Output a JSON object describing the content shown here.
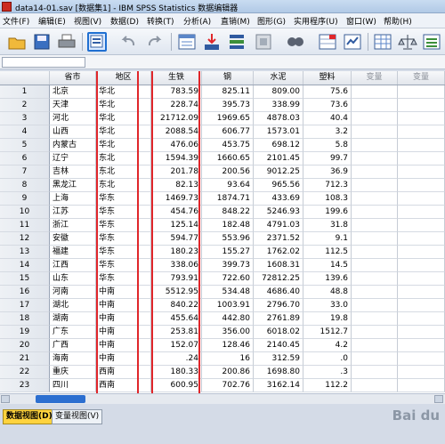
{
  "window": {
    "title": "data14-01.sav [数据集1] - IBM SPSS Statistics 数据编辑器"
  },
  "menu": [
    "文件(F)",
    "编辑(E)",
    "视图(V)",
    "数据(D)",
    "转换(T)",
    "分析(A)",
    "直销(M)",
    "图形(G)",
    "实用程序(U)",
    "窗口(W)",
    "帮助(H)"
  ],
  "toolbar": {
    "icons": [
      "open-folder",
      "save",
      "print",
      "dialog-recall",
      "undo",
      "redo",
      "go-to-case",
      "go-to-variable",
      "variables",
      "weight-cases",
      "find",
      "insert-cases",
      "insert-variable",
      "split-file",
      "select-cases",
      "value-labels",
      "use-variable-sets",
      "spelling"
    ]
  },
  "grid": {
    "headers": [
      "省市",
      "地区",
      "生铁",
      "钢",
      "水泥",
      "塑料",
      "变量",
      "变量"
    ],
    "rows": [
      {
        "n": "1",
        "c": [
          "北京",
          "华北",
          "783.59",
          "825.11",
          "809.00",
          "75.6"
        ]
      },
      {
        "n": "2",
        "c": [
          "天津",
          "华北",
          "228.74",
          "395.73",
          "338.99",
          "73.6"
        ]
      },
      {
        "n": "3",
        "c": [
          "河北",
          "华北",
          "21712.09",
          "1969.65",
          "4878.03",
          "40.4"
        ]
      },
      {
        "n": "4",
        "c": [
          "山西",
          "华北",
          "2088.54",
          "606.77",
          "1573.01",
          "3.2"
        ]
      },
      {
        "n": "5",
        "c": [
          "内蒙古",
          "华北",
          "476.06",
          "453.75",
          "698.12",
          "5.8"
        ]
      },
      {
        "n": "6",
        "c": [
          "辽宁",
          "东北",
          "1594.39",
          "1660.65",
          "2101.45",
          "99.7"
        ]
      },
      {
        "n": "7",
        "c": [
          "吉林",
          "东北",
          "201.78",
          "200.56",
          "9012.25",
          "36.9"
        ]
      },
      {
        "n": "8",
        "c": [
          "黑龙江",
          "东北",
          "82.13",
          "93.64",
          "965.56",
          "712.3"
        ]
      },
      {
        "n": "9",
        "c": [
          "上海",
          "华东",
          "1469.73",
          "1874.71",
          "433.69",
          "108.3"
        ]
      },
      {
        "n": "10",
        "c": [
          "江苏",
          "华东",
          "454.76",
          "848.22",
          "5246.93",
          "199.6"
        ]
      },
      {
        "n": "11",
        "c": [
          "浙江",
          "华东",
          "125.14",
          "182.48",
          "4791.03",
          "31.8"
        ]
      },
      {
        "n": "12",
        "c": [
          "安徽",
          "华东",
          "594.77",
          "553.96",
          "2371.52",
          "9.1"
        ]
      },
      {
        "n": "13",
        "c": [
          "福建",
          "华东",
          "180.23",
          "155.27",
          "1762.02",
          "112.5"
        ]
      },
      {
        "n": "14",
        "c": [
          "江西",
          "华东",
          "338.06",
          "399.73",
          "1608.31",
          "14.5"
        ]
      },
      {
        "n": "15",
        "c": [
          "山东",
          "华东",
          "793.91",
          "722.60",
          "72812.25",
          "139.6"
        ]
      },
      {
        "n": "16",
        "c": [
          "河南",
          "中南",
          "5512.95",
          "534.48",
          "4686.40",
          "48.8"
        ]
      },
      {
        "n": "17",
        "c": [
          "湖北",
          "中南",
          "840.22",
          "1003.91",
          "2796.70",
          "33.0"
        ]
      },
      {
        "n": "18",
        "c": [
          "湖南",
          "中南",
          "455.64",
          "442.80",
          "2761.89",
          "19.8"
        ]
      },
      {
        "n": "19",
        "c": [
          "广东",
          "中南",
          "253.81",
          "356.00",
          "6018.02",
          "1512.7"
        ]
      },
      {
        "n": "20",
        "c": [
          "广西",
          "中南",
          "152.07",
          "128.46",
          "2140.45",
          "4.2"
        ]
      },
      {
        "n": "21",
        "c": [
          "海南",
          "中南",
          ".24",
          "16",
          "312.59",
          ".0"
        ]
      },
      {
        "n": "22",
        "c": [
          "重庆",
          "西南",
          "180.33",
          "200.86",
          "1698.80",
          ".3"
        ]
      },
      {
        "n": "23",
        "c": [
          "四川",
          "西南",
          "600.95",
          "702.76",
          "3162.14",
          "112.2"
        ]
      }
    ]
  },
  "tabs": {
    "data_view": "数据视图(D)",
    "variable_view": "变量视图(V)"
  },
  "watermark": "Bai du",
  "colors": {
    "active_tab": "#ffd33e",
    "highlight_box": "#e0262a",
    "scroll_thumb": "#2c6fd0"
  }
}
